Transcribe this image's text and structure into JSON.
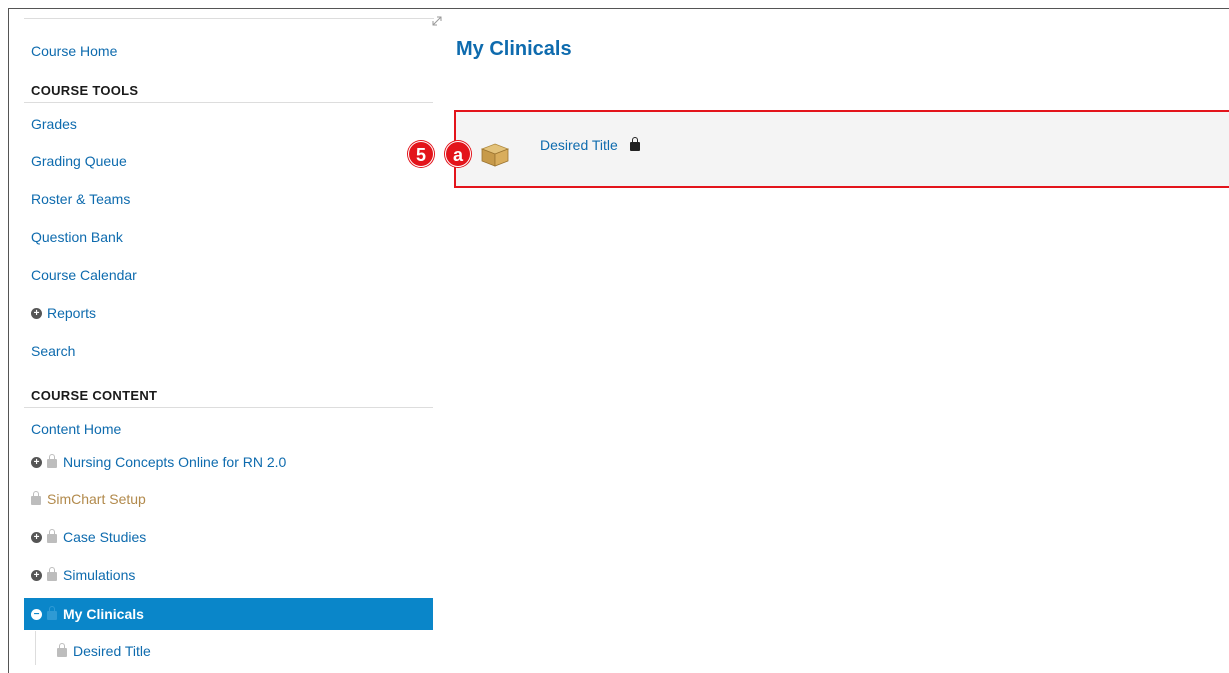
{
  "sidebar": {
    "course_home": "Course Home",
    "tools_heading": "COURSE TOOLS",
    "tools": [
      "Grades",
      "Grading Queue",
      "Roster & Teams",
      "Question Bank",
      "Course Calendar",
      "Reports",
      "Search"
    ],
    "content_heading": "COURSE CONTENT",
    "content_home": "Content Home",
    "content_items": [
      "Nursing Concepts Online for RN 2.0",
      "SimChart Setup",
      "Case Studies",
      "Simulations",
      "My Clinicals"
    ],
    "child_item": "Desired Title"
  },
  "main": {
    "title": "My Clinicals",
    "item_title": "Desired Title",
    "badge_step": "5",
    "badge_sub": "a"
  },
  "colors": {
    "link": "#0e6bae",
    "active_bg": "#0a86c9",
    "highlight_border": "#e3141b"
  }
}
